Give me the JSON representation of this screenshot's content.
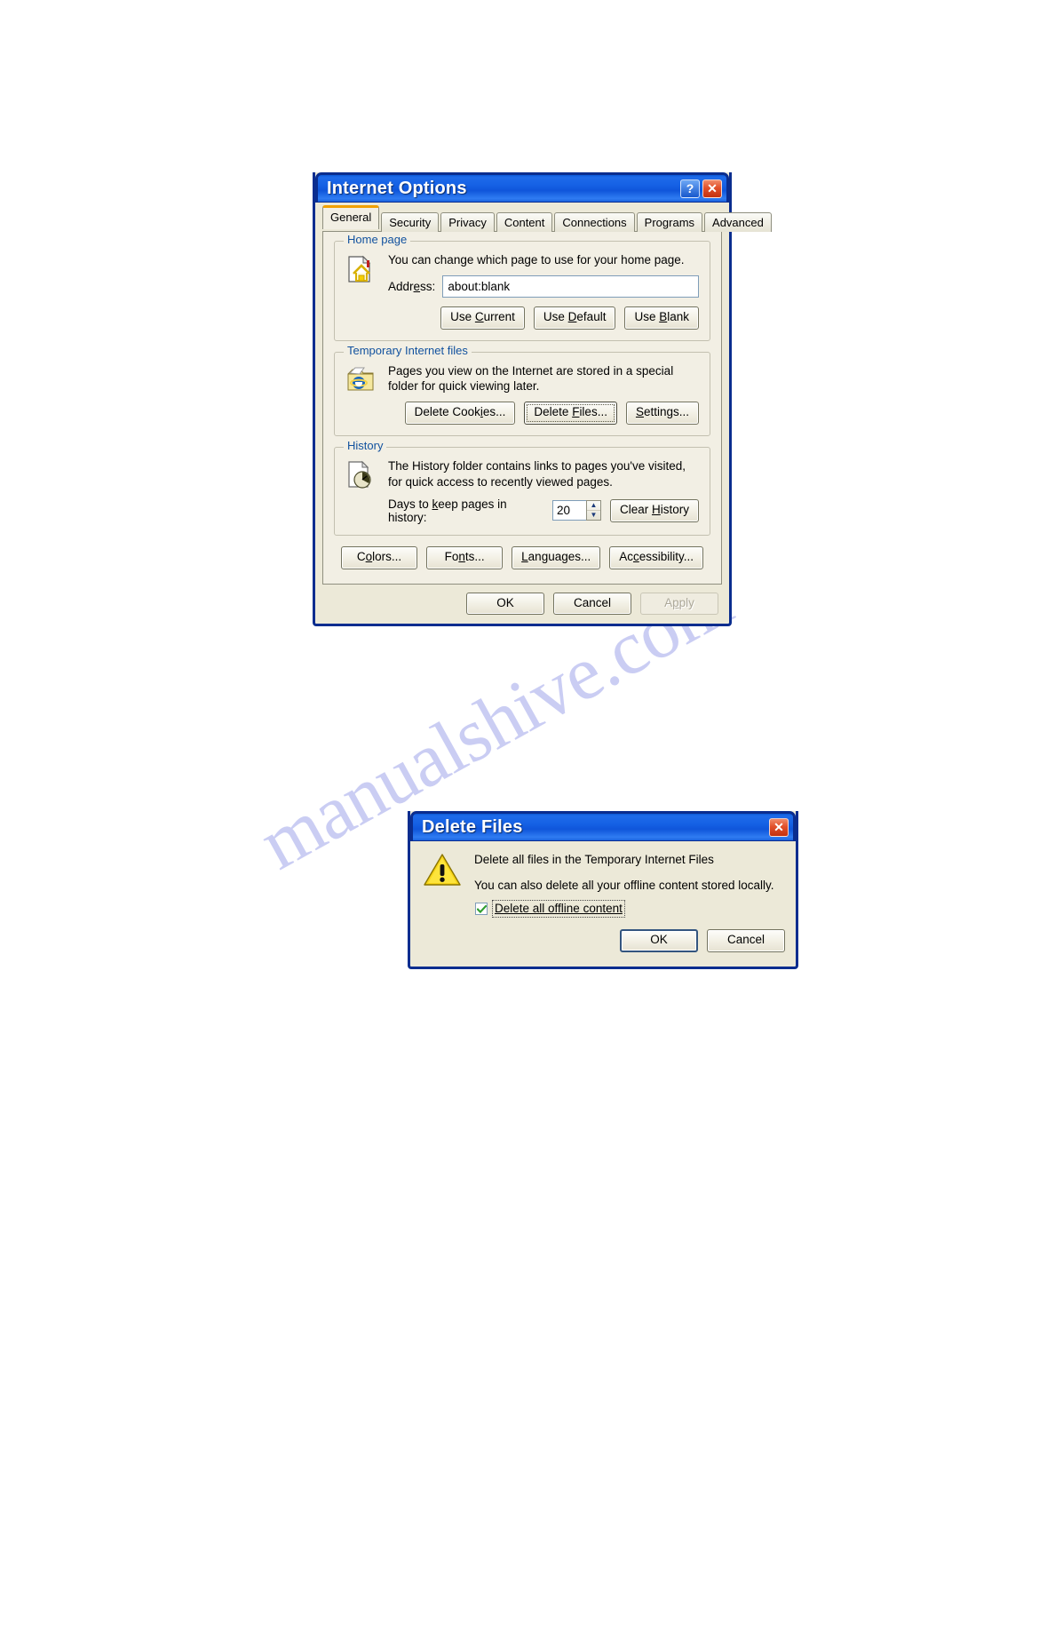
{
  "watermark": {
    "text": "manualshive.com",
    "color": "#b9bdf0"
  },
  "internet_options": {
    "title": "Internet Options",
    "titlebar_buttons": [
      {
        "name": "help-button",
        "glyph": "?"
      },
      {
        "name": "close-button",
        "glyph": "✕"
      }
    ],
    "tabs": [
      {
        "label": "General",
        "active": true
      },
      {
        "label": "Security",
        "active": false
      },
      {
        "label": "Privacy",
        "active": false
      },
      {
        "label": "Content",
        "active": false
      },
      {
        "label": "Connections",
        "active": false
      },
      {
        "label": "Programs",
        "active": false
      },
      {
        "label": "Advanced",
        "active": false
      }
    ],
    "home_page": {
      "group_title": "Home page",
      "icon": "home-page-icon",
      "description": "You can change which page to use for your home page.",
      "address_label": "Address:",
      "address_value": "about:blank",
      "buttons": [
        {
          "pre": "Use ",
          "accel": "C",
          "post": "urrent",
          "full": "Use Current"
        },
        {
          "pre": "Use ",
          "accel": "D",
          "post": "efault",
          "full": "Use Default"
        },
        {
          "pre": "Use ",
          "accel": "B",
          "post": "lank",
          "full": "Use Blank"
        }
      ]
    },
    "temporary_internet_files": {
      "group_title": "Temporary Internet files",
      "icon": "temp-files-folder-icon",
      "description": "Pages you view on the Internet are stored in a special folder for quick viewing later.",
      "buttons": [
        {
          "pre": "Delete Cook",
          "accel": "i",
          "post": "es...",
          "full": "Delete Cookies...",
          "focused": false
        },
        {
          "pre": "Delete ",
          "accel": "F",
          "post": "iles...",
          "full": "Delete Files...",
          "focused": true
        },
        {
          "pre": "",
          "accel": "S",
          "post": "ettings...",
          "full": "Settings...",
          "focused": false
        }
      ]
    },
    "history": {
      "group_title": "History",
      "icon": "history-clock-icon",
      "description": "The History folder contains links to pages you've visited, for quick access to recently viewed pages.",
      "days_label_pre": "Days to ",
      "days_label_accel": "k",
      "days_label_post": "eep pages in history:",
      "days_label_full": "Days to keep pages in history:",
      "days_value": "20",
      "spinner_up": "▲",
      "spinner_down": "▼",
      "clear_button": {
        "pre": "Clear ",
        "accel": "H",
        "post": "istory",
        "full": "Clear History"
      }
    },
    "bottom_buttons": [
      {
        "pre": "C",
        "accel": "o",
        "post": "lors...",
        "full": "Colors..."
      },
      {
        "pre": "Fo",
        "accel": "n",
        "post": "ts...",
        "full": "Fonts..."
      },
      {
        "pre": "",
        "accel": "L",
        "post": "anguages...",
        "full": "Languages..."
      },
      {
        "pre": "Ac",
        "accel": "c",
        "post": "essibility...",
        "full": "Accessibility..."
      }
    ],
    "footer_buttons": [
      {
        "label": "OK",
        "state": "default"
      },
      {
        "label": "Cancel",
        "state": "normal"
      },
      {
        "label": "Apply",
        "pre": "A",
        "accel": "p",
        "post": "ply",
        "state": "disabled"
      }
    ]
  },
  "delete_files": {
    "title": "Delete Files",
    "close_glyph": "✕",
    "icon": "warning-triangle-icon",
    "line1": "Delete all files in the Temporary Internet Files",
    "line2": "You can also delete all your offline content stored locally.",
    "checkbox": {
      "label": "Delete all offline content",
      "checked": true
    },
    "buttons": [
      {
        "label": "OK",
        "state": "default"
      },
      {
        "label": "Cancel",
        "state": "normal"
      }
    ]
  }
}
